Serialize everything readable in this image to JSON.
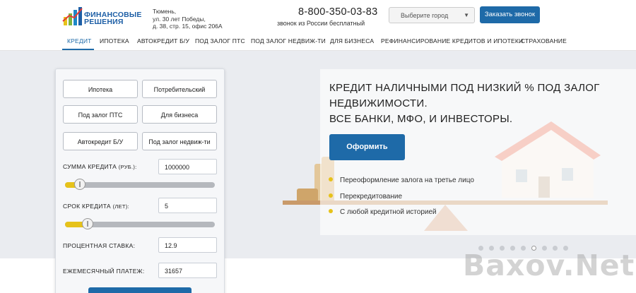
{
  "header": {
    "logo_line1": "ФИНАНСОВЫЕ",
    "logo_line2": "РЕШЕНИЯ",
    "address_line1": "Тюмень,",
    "address_line2": "ул. 30 лет Победы,",
    "address_line3": "д. 38, стр. 15, офис 206А",
    "phone": "8-800-350-03-83",
    "phone_note": "звонок из России бесплатный",
    "city_placeholder": "Выберите город",
    "call_button": "Заказать звонок"
  },
  "nav": {
    "items": [
      {
        "label": "КРЕДИТ",
        "active": true
      },
      {
        "label": "ИПОТЕКА"
      },
      {
        "label": "АВТОКРЕДИТ Б/У"
      },
      {
        "label": "ПОД ЗАЛОГ ПТС"
      },
      {
        "label": "ПОД ЗАЛОГ НЕДВИЖ-ТИ"
      },
      {
        "label": "ДЛЯ БИЗНЕСА"
      },
      {
        "label": "РЕФИНАНСИРОВАНИЕ КРЕДИТОВ И ИПОТЕКИ"
      },
      {
        "label": "СТРАХОВАНИЕ"
      }
    ]
  },
  "calculator": {
    "types": [
      "Ипотека",
      "Потребительский",
      "Под залог ПТС",
      "Для бизнеса",
      "Автокредит Б/У",
      "Под залог недвиж-ти"
    ],
    "amount_label": "СУММА КРЕДИТА",
    "amount_unit": "(РУБ.):",
    "amount_value": "1000000",
    "amount_slider_fraction": 0.1,
    "term_label": "СРОК КРЕДИТА",
    "term_unit": "(ЛЕТ):",
    "term_value": "5",
    "term_slider_fraction": 0.15,
    "rate_label": "ПРОЦЕНТНАЯ СТАВКА:",
    "rate_value": "12.9",
    "payment_label": "ЕЖЕМЕСЯЧНЫЙ ПЛАТЕЖ:",
    "payment_value": "31657"
  },
  "promo": {
    "title_line1": "КРЕДИТ НАЛИЧНЫМИ ПОД НИЗКИЙ % ПОД ЗАЛОГ",
    "title_line2": "НЕДВИЖИМОСТИ.",
    "title_line3": "ВСЕ БАНКИ, МФО, И ИНВЕСТОРЫ.",
    "button": "Оформить",
    "bullets": [
      "Переоформление залога на третье лицо",
      "Перекредитование",
      "С любой кредитной историей"
    ]
  },
  "slider_dots": {
    "count": 9,
    "active_index": 5
  },
  "watermark": "Baxov.Net",
  "colors": {
    "accent": "#1e6aa8",
    "bullet": "#e6c21a",
    "hero_bg": "#eaecf0"
  }
}
